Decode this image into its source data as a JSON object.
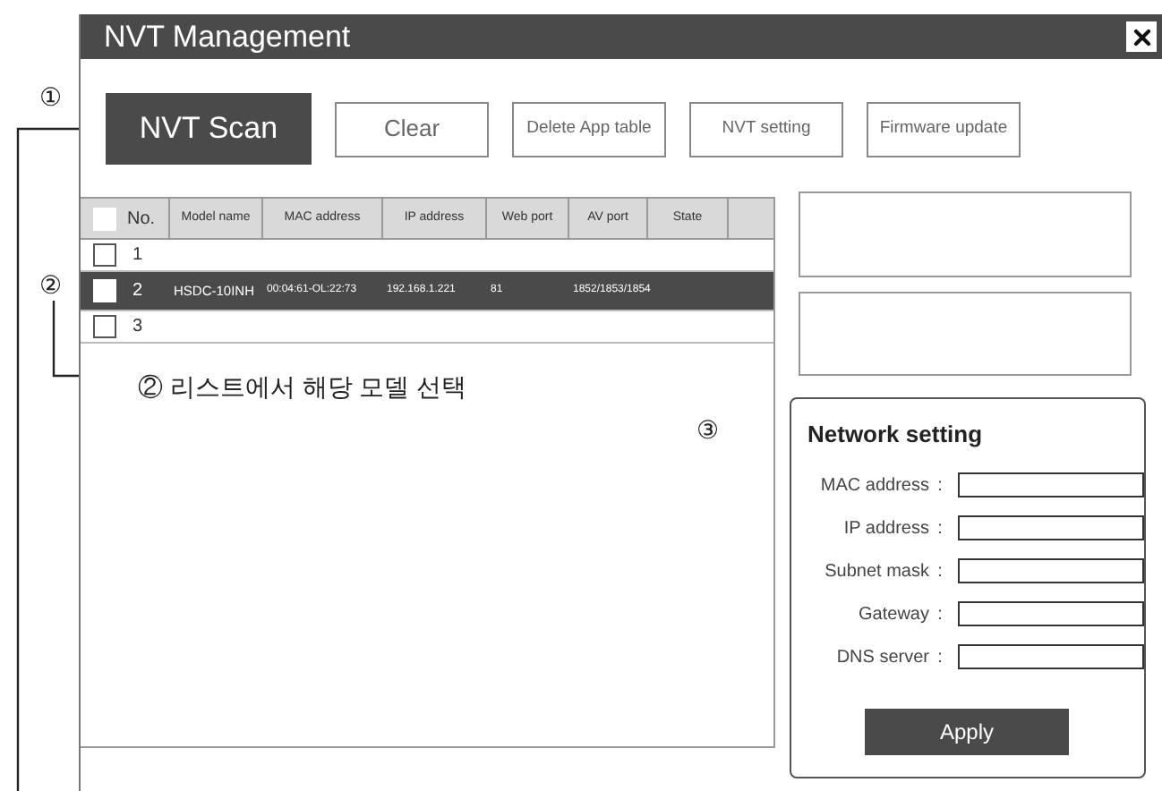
{
  "window": {
    "title": "NVT Management"
  },
  "toolbar": [
    {
      "label": "NVT Scan",
      "kind": "primary"
    },
    {
      "label": "Clear",
      "kind": "outline"
    },
    {
      "label": "Delete App table",
      "kind": "outline"
    },
    {
      "label": "NVT setting",
      "kind": "outline"
    },
    {
      "label": "Firmware update",
      "kind": "outline"
    }
  ],
  "table": {
    "header_checkbox": {
      "checked": false
    },
    "columns": [
      "No.",
      "Model name",
      "MAC address",
      "IP address",
      "Web port",
      "AV port",
      "State"
    ],
    "rows": [
      {
        "checked": false,
        "selected": false,
        "cells": [
          "1",
          "",
          "",
          "",
          "",
          "",
          ""
        ]
      },
      {
        "checked": false,
        "selected": true,
        "cells": [
          "2",
          "HSDC-10INH",
          "00:04:61-OL:22:73",
          "192.168.1.221",
          "81",
          "1852/1853/1854",
          ""
        ]
      },
      {
        "checked": false,
        "selected": false,
        "cells": [
          "3",
          "",
          "",
          "",
          "",
          "",
          ""
        ]
      }
    ]
  },
  "network_setting": {
    "title": "Network setting",
    "fields": [
      {
        "label": "MAC address"
      },
      {
        "label": "IP address"
      },
      {
        "label": "Subnet mask"
      },
      {
        "label": "Gateway"
      },
      {
        "label": "DNS server"
      }
    ],
    "separator": ":",
    "apply": "Apply"
  },
  "callouts": {
    "marker_1": "①",
    "marker_2": "②",
    "note_2": "② 리스트에서 해당 모델 선택",
    "marker_3": "③"
  }
}
